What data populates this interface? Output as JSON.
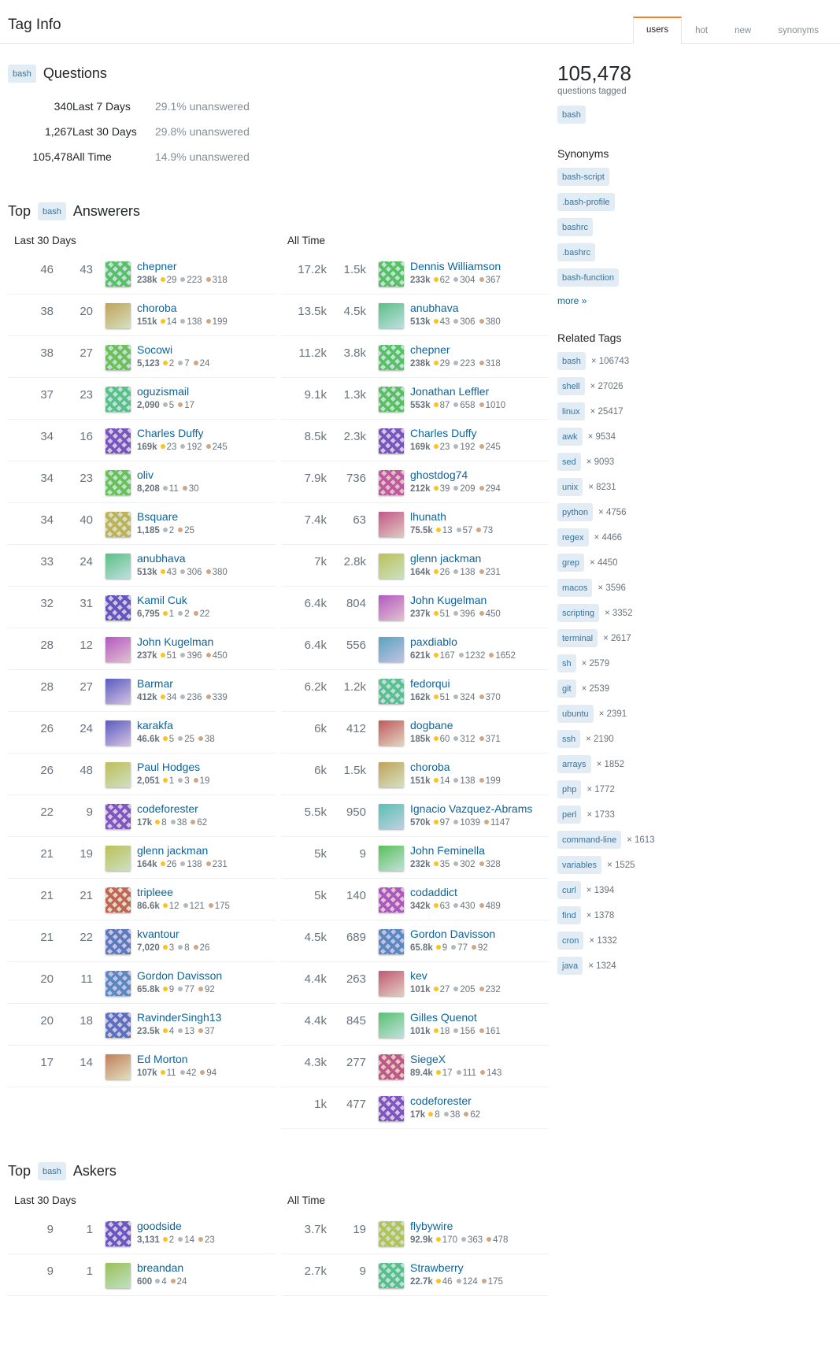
{
  "header": {
    "title": "Tag Info",
    "tabs": [
      {
        "label": "users",
        "active": true
      },
      {
        "label": "hot",
        "active": false
      },
      {
        "label": "new",
        "active": false
      },
      {
        "label": "synonyms",
        "active": false
      }
    ]
  },
  "questions": {
    "tag": "bash",
    "heading": "Questions",
    "rows": [
      {
        "count": "340",
        "period": "Last 7 Days",
        "unanswered": "29.1% unanswered"
      },
      {
        "count": "1,267",
        "period": "Last 30 Days",
        "unanswered": "29.8% unanswered"
      },
      {
        "count": "105,478",
        "period": "All Time",
        "unanswered": "14.9% unanswered"
      }
    ]
  },
  "answerers": {
    "title_prefix": "Top",
    "tag": "bash",
    "title_suffix": "Answerers",
    "left_heading": "Last 30 Days",
    "right_heading": "All Time",
    "last30": [
      {
        "score": "46",
        "posts": "43",
        "name": "chepner",
        "rep": "238k",
        "gold": "29",
        "silver": "223",
        "bronze": "318",
        "avatar": "identicon-chepner"
      },
      {
        "score": "38",
        "posts": "20",
        "name": "choroba",
        "rep": "151k",
        "gold": "14",
        "silver": "138",
        "bronze": "199",
        "avatar": "photo-choroba"
      },
      {
        "score": "38",
        "posts": "27",
        "name": "Socowi",
        "rep": "5,123",
        "gold": "2",
        "silver": "7",
        "bronze": "24",
        "avatar": "logo-socowi"
      },
      {
        "score": "37",
        "posts": "23",
        "name": "oguzismail",
        "rep": "2,090",
        "gold": "",
        "silver": "5",
        "bronze": "17",
        "avatar": "identicon-oguzismail"
      },
      {
        "score": "34",
        "posts": "16",
        "name": "Charles Duffy",
        "rep": "169k",
        "gold": "23",
        "silver": "192",
        "bronze": "245",
        "avatar": "logo-charlesduffy"
      },
      {
        "score": "34",
        "posts": "23",
        "name": "oliv",
        "rep": "8,208",
        "gold": "",
        "silver": "11",
        "bronze": "30",
        "avatar": "identicon-oliv"
      },
      {
        "score": "34",
        "posts": "40",
        "name": "Bsquare",
        "rep": "1,185",
        "gold": "",
        "silver": "2",
        "bronze": "25",
        "avatar": "identicon-bsquare"
      },
      {
        "score": "33",
        "posts": "24",
        "name": "anubhava",
        "rep": "513k",
        "gold": "43",
        "silver": "306",
        "bronze": "380",
        "avatar": "photo-anubhava"
      },
      {
        "score": "32",
        "posts": "31",
        "name": "Kamil Cuk",
        "rep": "6,795",
        "gold": "1",
        "silver": "2",
        "bronze": "22",
        "avatar": "identicon-kamilcuk"
      },
      {
        "score": "28",
        "posts": "12",
        "name": "John Kugelman",
        "rep": "237k",
        "gold": "51",
        "silver": "396",
        "bronze": "450",
        "avatar": "photo-johnkugelman"
      },
      {
        "score": "28",
        "posts": "27",
        "name": "Barmar",
        "rep": "412k",
        "gold": "34",
        "silver": "236",
        "bronze": "339",
        "avatar": "photo-barmar"
      },
      {
        "score": "26",
        "posts": "24",
        "name": "karakfa",
        "rep": "46.6k",
        "gold": "5",
        "silver": "25",
        "bronze": "38",
        "avatar": "photo-karakfa"
      },
      {
        "score": "26",
        "posts": "48",
        "name": "Paul Hodges",
        "rep": "2,051",
        "gold": "1",
        "silver": "3",
        "bronze": "19",
        "avatar": "photo-paulhodges"
      },
      {
        "score": "22",
        "posts": "9",
        "name": "codeforester",
        "rep": "17k",
        "gold": "8",
        "silver": "38",
        "bronze": "62",
        "avatar": "identicon-codeforester"
      },
      {
        "score": "21",
        "posts": "19",
        "name": "glenn jackman",
        "rep": "164k",
        "gold": "26",
        "silver": "138",
        "bronze": "231",
        "avatar": "photo-glennjackman"
      },
      {
        "score": "21",
        "posts": "21",
        "name": "tripleee",
        "rep": "86.6k",
        "gold": "12",
        "silver": "121",
        "bronze": "175",
        "avatar": "logo-tripleee"
      },
      {
        "score": "21",
        "posts": "22",
        "name": "kvantour",
        "rep": "7,020",
        "gold": "3",
        "silver": "8",
        "bronze": "26",
        "avatar": "identicon-kvantour"
      },
      {
        "score": "20",
        "posts": "11",
        "name": "Gordon Davisson",
        "rep": "65.8k",
        "gold": "9",
        "silver": "77",
        "bronze": "92",
        "avatar": "identicon-gordondavisson"
      },
      {
        "score": "20",
        "posts": "18",
        "name": "RavinderSingh13",
        "rep": "23.5k",
        "gold": "4",
        "silver": "13",
        "bronze": "37",
        "avatar": "identicon-ravindersingh13"
      },
      {
        "score": "17",
        "posts": "14",
        "name": "Ed Morton",
        "rep": "107k",
        "gold": "11",
        "silver": "42",
        "bronze": "94",
        "avatar": "photo-edmorton"
      }
    ],
    "alltime": [
      {
        "score": "17.2k",
        "posts": "1.5k",
        "name": "Dennis Williamson",
        "rep": "233k",
        "gold": "62",
        "silver": "304",
        "bronze": "367",
        "avatar": "identicon-denniswilliamson"
      },
      {
        "score": "13.5k",
        "posts": "4.5k",
        "name": "anubhava",
        "rep": "513k",
        "gold": "43",
        "silver": "306",
        "bronze": "380",
        "avatar": "photo-anubhava"
      },
      {
        "score": "11.2k",
        "posts": "3.8k",
        "name": "chepner",
        "rep": "238k",
        "gold": "29",
        "silver": "223",
        "bronze": "318",
        "avatar": "identicon-chepner"
      },
      {
        "score": "9.1k",
        "posts": "1.3k",
        "name": "Jonathan Leffler",
        "rep": "553k",
        "gold": "87",
        "silver": "658",
        "bronze": "1010",
        "avatar": "identicon-jonathanleffler"
      },
      {
        "score": "8.5k",
        "posts": "2.3k",
        "name": "Charles Duffy",
        "rep": "169k",
        "gold": "23",
        "silver": "192",
        "bronze": "245",
        "avatar": "logo-charlesduffy"
      },
      {
        "score": "7.9k",
        "posts": "736",
        "name": "ghostdog74",
        "rep": "212k",
        "gold": "39",
        "silver": "209",
        "bronze": "294",
        "avatar": "identicon-ghostdog74"
      },
      {
        "score": "7.4k",
        "posts": "63",
        "name": "lhunath",
        "rep": "75.5k",
        "gold": "13",
        "silver": "57",
        "bronze": "73",
        "avatar": "photo-lhunath"
      },
      {
        "score": "7k",
        "posts": "2.8k",
        "name": "glenn jackman",
        "rep": "164k",
        "gold": "26",
        "silver": "138",
        "bronze": "231",
        "avatar": "photo-glennjackman"
      },
      {
        "score": "6.4k",
        "posts": "804",
        "name": "John Kugelman",
        "rep": "237k",
        "gold": "51",
        "silver": "396",
        "bronze": "450",
        "avatar": "photo-johnkugelman"
      },
      {
        "score": "6.4k",
        "posts": "556",
        "name": "paxdiablo",
        "rep": "621k",
        "gold": "167",
        "silver": "1232",
        "bronze": "1652",
        "avatar": "photo-paxdiablo"
      },
      {
        "score": "6.2k",
        "posts": "1.2k",
        "name": "fedorqui",
        "rep": "162k",
        "gold": "51",
        "silver": "324",
        "bronze": "370",
        "avatar": "logo-fedorqui"
      },
      {
        "score": "6k",
        "posts": "412",
        "name": "dogbane",
        "rep": "185k",
        "gold": "60",
        "silver": "312",
        "bronze": "371",
        "avatar": "photo-dogbane"
      },
      {
        "score": "6k",
        "posts": "1.5k",
        "name": "choroba",
        "rep": "151k",
        "gold": "14",
        "silver": "138",
        "bronze": "199",
        "avatar": "photo-choroba"
      },
      {
        "score": "5.5k",
        "posts": "950",
        "name": "Ignacio Vazquez-Abrams",
        "rep": "570k",
        "gold": "97",
        "silver": "1039",
        "bronze": "1147",
        "avatar": "photo-ignacio"
      },
      {
        "score": "5k",
        "posts": "9",
        "name": "John Feminella",
        "rep": "232k",
        "gold": "35",
        "silver": "302",
        "bronze": "328",
        "avatar": "photo-johnfeminella"
      },
      {
        "score": "5k",
        "posts": "140",
        "name": "codaddict",
        "rep": "342k",
        "gold": "63",
        "silver": "430",
        "bronze": "489",
        "avatar": "logo-codaddict"
      },
      {
        "score": "4.5k",
        "posts": "689",
        "name": "Gordon Davisson",
        "rep": "65.8k",
        "gold": "9",
        "silver": "77",
        "bronze": "92",
        "avatar": "identicon-gordondavisson"
      },
      {
        "score": "4.4k",
        "posts": "263",
        "name": "kev",
        "rep": "101k",
        "gold": "27",
        "silver": "205",
        "bronze": "232",
        "avatar": "photo-kev"
      },
      {
        "score": "4.4k",
        "posts": "845",
        "name": "Gilles Quenot",
        "rep": "101k",
        "gold": "18",
        "silver": "156",
        "bronze": "161",
        "avatar": "photo-gillesquenot"
      },
      {
        "score": "4.3k",
        "posts": "277",
        "name": "SiegeX",
        "rep": "89.4k",
        "gold": "17",
        "silver": "111",
        "bronze": "143",
        "avatar": "logo-siegex"
      },
      {
        "score": "1k",
        "posts": "477",
        "name": "codeforester",
        "rep": "17k",
        "gold": "8",
        "silver": "38",
        "bronze": "62",
        "avatar": "identicon-codeforester"
      }
    ]
  },
  "askers": {
    "title_prefix": "Top",
    "tag": "bash",
    "title_suffix": "Askers",
    "left_heading": "Last 30 Days",
    "right_heading": "All Time",
    "last30": [
      {
        "score": "9",
        "posts": "1",
        "name": "goodside",
        "rep": "3,131",
        "gold": "2",
        "silver": "14",
        "bronze": "23",
        "avatar": "identicon-goodside"
      },
      {
        "score": "9",
        "posts": "1",
        "name": "breandan",
        "rep": "600",
        "gold": "",
        "silver": "4",
        "bronze": "24",
        "avatar": "photo-breandan"
      }
    ],
    "alltime": [
      {
        "score": "3.7k",
        "posts": "19",
        "name": "flybywire",
        "rep": "92.9k",
        "gold": "170",
        "silver": "363",
        "bronze": "478",
        "avatar": "identicon-flybywire"
      },
      {
        "score": "2.7k",
        "posts": "9",
        "name": "Strawberry",
        "rep": "22.7k",
        "gold": "46",
        "silver": "124",
        "bronze": "175",
        "avatar": "identicon-strawberry"
      }
    ]
  },
  "sidebar": {
    "question_count": "105,478",
    "question_count_label": "questions tagged",
    "main_tag": "bash",
    "synonyms_heading": "Synonyms",
    "synonyms": [
      "bash-script",
      ".bash-profile",
      "bashrc",
      ".bashrc",
      "bash-function"
    ],
    "more_label": "more »",
    "related_heading": "Related Tags",
    "related": [
      {
        "tag": "bash",
        "count": "× 106743"
      },
      {
        "tag": "shell",
        "count": "× 27026"
      },
      {
        "tag": "linux",
        "count": "× 25417"
      },
      {
        "tag": "awk",
        "count": "× 9534"
      },
      {
        "tag": "sed",
        "count": "× 9093"
      },
      {
        "tag": "unix",
        "count": "× 8231"
      },
      {
        "tag": "python",
        "count": "× 4756"
      },
      {
        "tag": "regex",
        "count": "× 4466"
      },
      {
        "tag": "grep",
        "count": "× 4450"
      },
      {
        "tag": "macos",
        "count": "× 3596"
      },
      {
        "tag": "scripting",
        "count": "× 3352"
      },
      {
        "tag": "terminal",
        "count": "× 2617"
      },
      {
        "tag": "sh",
        "count": "× 2579"
      },
      {
        "tag": "git",
        "count": "× 2539"
      },
      {
        "tag": "ubuntu",
        "count": "× 2391"
      },
      {
        "tag": "ssh",
        "count": "× 2190"
      },
      {
        "tag": "arrays",
        "count": "× 1852"
      },
      {
        "tag": "php",
        "count": "× 1772"
      },
      {
        "tag": "perl",
        "count": "× 1733"
      },
      {
        "tag": "command-line",
        "count": "× 1613"
      },
      {
        "tag": "variables",
        "count": "× 1525"
      },
      {
        "tag": "curl",
        "count": "× 1394"
      },
      {
        "tag": "find",
        "count": "× 1378"
      },
      {
        "tag": "cron",
        "count": "× 1332"
      },
      {
        "tag": "java",
        "count": "× 1324"
      }
    ]
  },
  "colors": {
    "accent": "#f48024",
    "link": "#0c649b",
    "tag_bg": "#e1ecf4",
    "tag_fg": "#39739d",
    "gold": "#fcc419",
    "silver": "#b4b8bc",
    "bronze": "#d1a684"
  }
}
